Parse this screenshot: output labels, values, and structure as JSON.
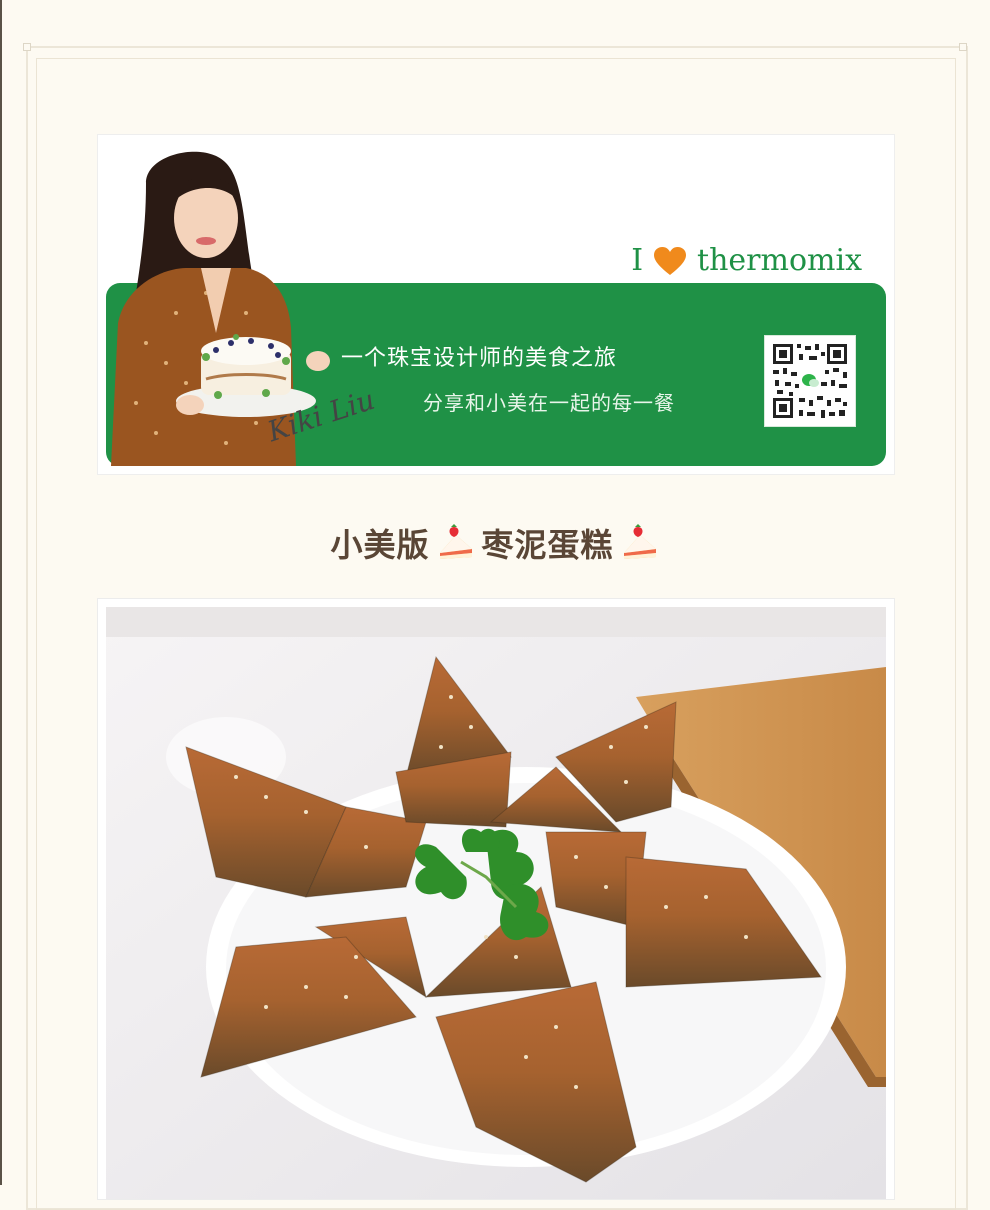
{
  "banner": {
    "love_prefix": "I",
    "love_brand": "thermomix",
    "slogan_line1": "一个珠宝设计师的美食之旅",
    "slogan_line2": "分享和小美在一起的每一餐",
    "signature": "Kiki Liu",
    "qr_icon": "wechat-qr-code-icon",
    "heart_icon": "heart-icon",
    "colors": {
      "green": "#1f9146",
      "heart": "#f08a1c"
    }
  },
  "article": {
    "title_prefix": "小美版",
    "title_main": "枣泥蛋糕",
    "title_icon": "strawberry-shortcake-icon"
  },
  "photo": {
    "subject": "jujube-cake-photo"
  }
}
